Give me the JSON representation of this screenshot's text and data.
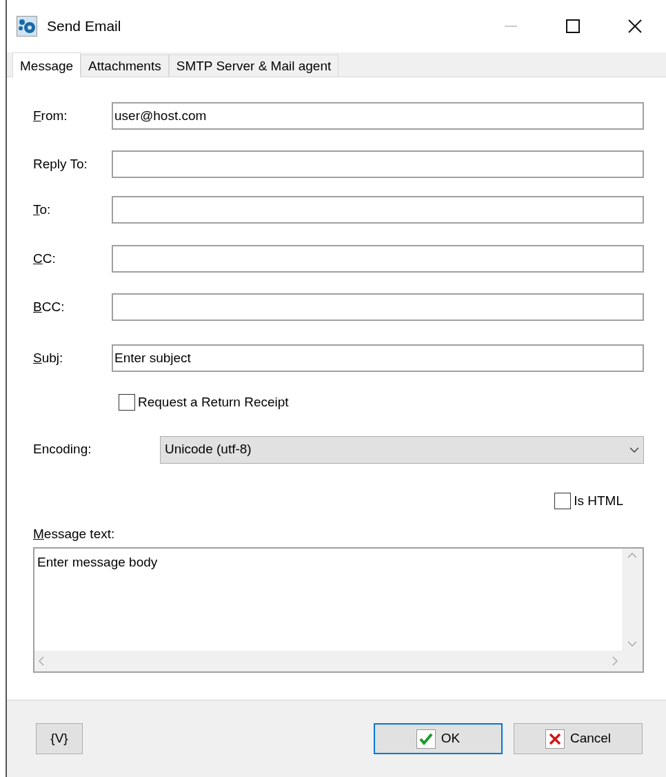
{
  "window": {
    "title": "Send Email",
    "controls": [
      {
        "kind": "minimize",
        "disabled": true
      },
      {
        "kind": "maximize",
        "disabled": false
      },
      {
        "kind": "close",
        "disabled": false
      }
    ]
  },
  "tabs": [
    {
      "label": "Message",
      "selected": true
    },
    {
      "label": "Attachments",
      "selected": false
    },
    {
      "label": "SMTP Server & Mail agent",
      "selected": false
    }
  ],
  "fields": [
    {
      "label": "From:",
      "underline_first": true,
      "value": "user@host.com"
    },
    {
      "label": "Reply To:",
      "underline_first": false
    },
    {
      "label": "To:",
      "underline_first": true
    },
    {
      "label": "CC:",
      "underline_first": true
    },
    {
      "label": "BCC:",
      "underline_first": true
    },
    {
      "label": "Subj:",
      "underline_first": true,
      "value": "Enter subject"
    }
  ],
  "return_receipt": {
    "label": "Request a Return Receipt",
    "checked": false
  },
  "encoding": {
    "label": "Encoding:",
    "value": "Unicode (utf-8)"
  },
  "is_html": {
    "label": "Is HTML",
    "checked": false
  },
  "message": {
    "label": "Message text:",
    "underline_first": true,
    "value": "Enter message body"
  },
  "buttons": [
    {
      "kind": "variables",
      "label": "{V}",
      "default": false
    },
    {
      "kind": "ok",
      "label": "OK",
      "default": true
    },
    {
      "kind": "cancel",
      "label": "Cancel",
      "default": false
    }
  ]
}
